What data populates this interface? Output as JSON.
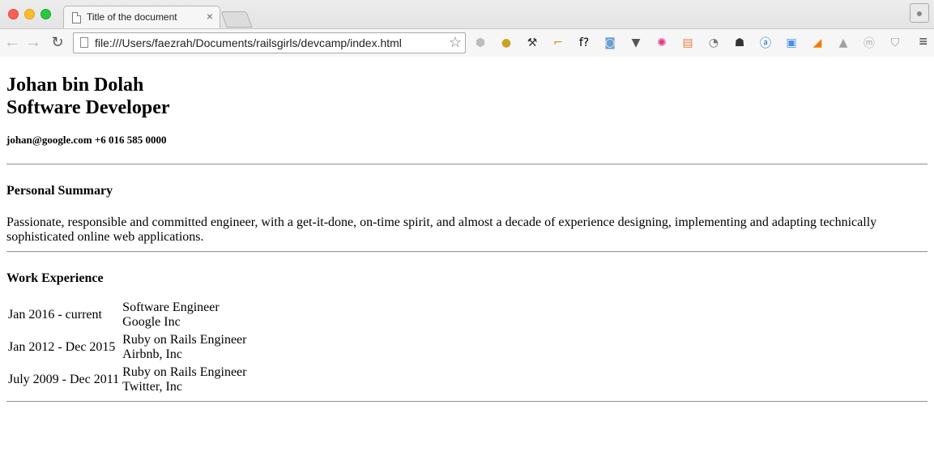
{
  "browser": {
    "tab_title": "Title of the document",
    "tab_close": "×",
    "url": "file:///Users/faezrah/Documents/railsgirls/devcamp/index.html",
    "extensions": [
      {
        "icon": "cube-extension-icon",
        "glyph": "⬢",
        "color": "#bdbdbd"
      },
      {
        "icon": "bulb-extension-icon",
        "glyph": "●",
        "color": "#c9a227"
      },
      {
        "icon": "wand-extension-icon",
        "glyph": "⚒",
        "color": "#333333"
      },
      {
        "icon": "ruler-extension-icon",
        "glyph": "⌐",
        "color": "#e08a00"
      },
      {
        "icon": "font-extension-icon",
        "glyph": "f?",
        "color": "#000000"
      },
      {
        "icon": "camera-extension-icon",
        "glyph": "◙",
        "color": "#6a9fd2"
      },
      {
        "icon": "pocket-extension-icon",
        "glyph": "▼",
        "color": "#555555"
      },
      {
        "icon": "color-wheel-extension-icon",
        "glyph": "✺",
        "color": "#e0388a"
      },
      {
        "icon": "window-extension-icon",
        "glyph": "▤",
        "color": "#e57f45"
      },
      {
        "icon": "timer-extension-icon",
        "glyph": "◔",
        "color": "#777777"
      },
      {
        "icon": "ghostery-extension-icon",
        "glyph": "☗",
        "color": "#333333"
      },
      {
        "icon": "a-circle-extension-icon",
        "glyph": "ⓐ",
        "color": "#1a73c9"
      },
      {
        "icon": "card-extension-icon",
        "glyph": "▣",
        "color": "#4a8fe7"
      },
      {
        "icon": "chart-extension-icon",
        "glyph": "◢",
        "color": "#f57c00"
      },
      {
        "icon": "drive-extension-icon",
        "glyph": "▲",
        "color": "#a0a0a0"
      },
      {
        "icon": "m-circle-extension-icon",
        "glyph": "ⓜ",
        "color": "#a8a8a8"
      },
      {
        "icon": "shield-extension-icon",
        "glyph": "⛉",
        "color": "#9a9a9a"
      }
    ]
  },
  "resume": {
    "name": "Johan bin Dolah",
    "title": "Software Developer",
    "contact": "johan@google.com +6 016 585 0000",
    "summary_heading": "Personal Summary",
    "summary_text": "Passionate, responsible and committed engineer, with a get-it-done, on-time spirit, and almost a decade of experience designing, implementing and adapting technically sophisticated online web applications.",
    "work_heading": "Work Experience",
    "work": [
      {
        "period": "Jan 2016 - current",
        "role": "Software Engineer",
        "company": "Google Inc"
      },
      {
        "period": "Jan 2012 - Dec 2015",
        "role": "Ruby on Rails Engineer",
        "company": "Airbnb, Inc"
      },
      {
        "period": "July 2009 - Dec 2011",
        "role": "Ruby on Rails Engineer",
        "company": "Twitter, Inc"
      }
    ]
  }
}
